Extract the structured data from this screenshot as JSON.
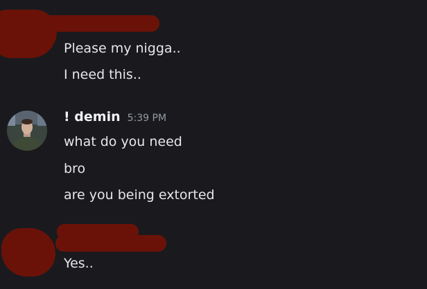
{
  "messages": [
    {
      "group": "first",
      "lines": [
        "Please my nigga..",
        "I need this.."
      ]
    },
    {
      "group": "demin",
      "username": "! demin",
      "timestamp": "5:39 PM",
      "lines": [
        "what do you need",
        "bro",
        "are you being extorted"
      ]
    },
    {
      "group": "last",
      "lines": [
        "Yes.."
      ]
    }
  ],
  "colors": {
    "background": "#1a1a1e",
    "redaction": "#6b1208",
    "text": "#e6e7e9",
    "timestamp": "#949ba4"
  },
  "icons": {
    "avatar": "user-avatar-photo"
  }
}
